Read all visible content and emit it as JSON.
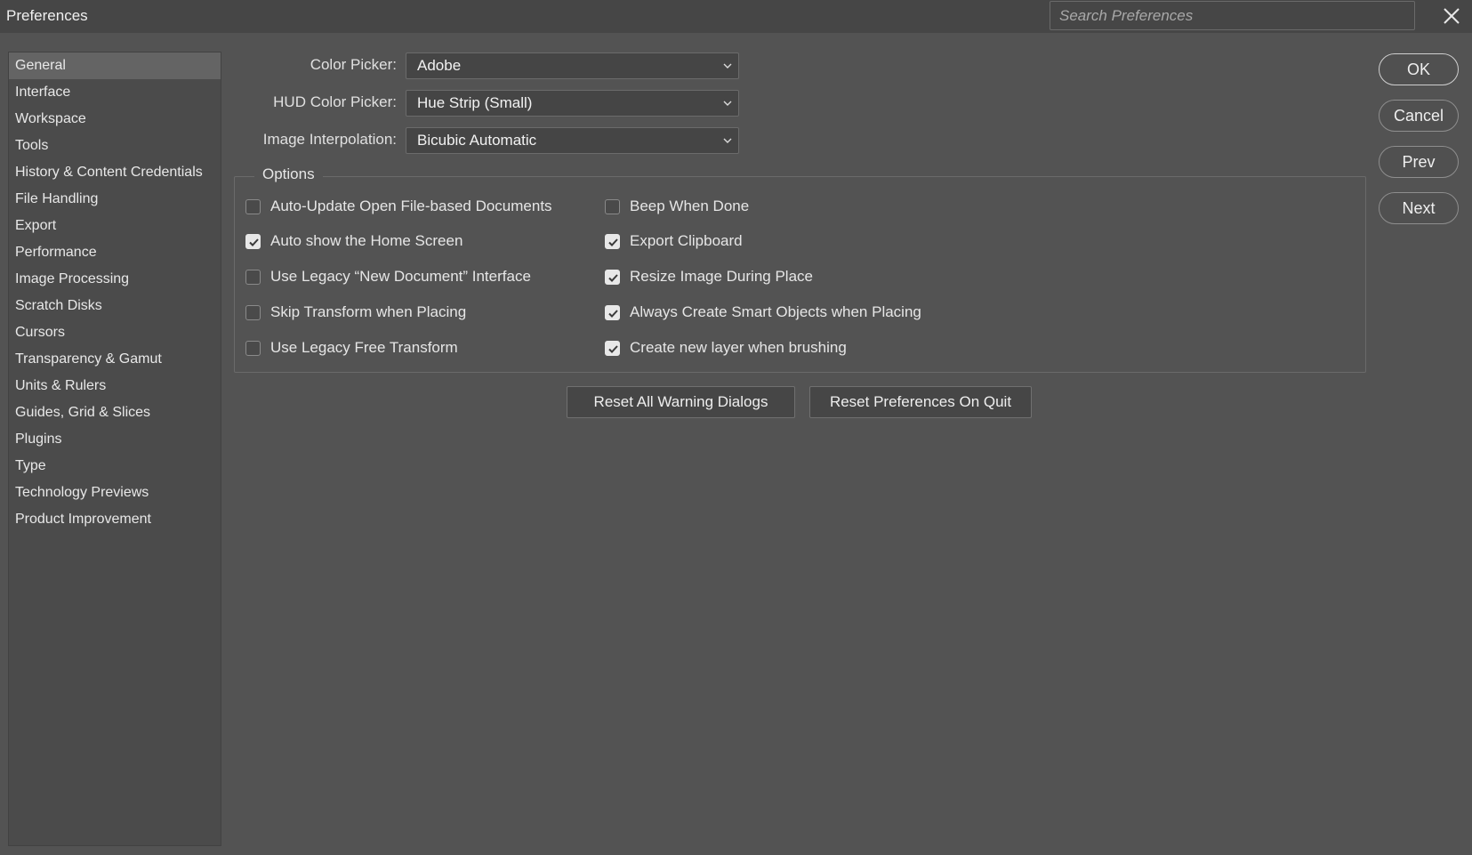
{
  "window": {
    "title": "Preferences",
    "search_placeholder": "Search Preferences"
  },
  "sidebar": {
    "items": [
      {
        "label": "General",
        "selected": true
      },
      {
        "label": "Interface"
      },
      {
        "label": "Workspace"
      },
      {
        "label": "Tools"
      },
      {
        "label": "History & Content Credentials"
      },
      {
        "label": "File Handling"
      },
      {
        "label": "Export"
      },
      {
        "label": "Performance"
      },
      {
        "label": "Image Processing"
      },
      {
        "label": "Scratch Disks"
      },
      {
        "label": "Cursors"
      },
      {
        "label": "Transparency & Gamut"
      },
      {
        "label": "Units & Rulers"
      },
      {
        "label": "Guides, Grid & Slices"
      },
      {
        "label": "Plugins"
      },
      {
        "label": "Type"
      },
      {
        "label": "Technology Previews"
      },
      {
        "label": "Product Improvement"
      }
    ]
  },
  "fields": {
    "color_picker": {
      "label": "Color Picker:",
      "value": "Adobe"
    },
    "hud_color_picker": {
      "label": "HUD Color Picker:",
      "value": "Hue Strip (Small)"
    },
    "image_interpolation": {
      "label": "Image Interpolation:",
      "value": "Bicubic Automatic"
    }
  },
  "options": {
    "title": "Options",
    "left": [
      {
        "label": "Auto-Update Open File-based Documents",
        "checked": false
      },
      {
        "label": "Auto show the Home Screen",
        "checked": true
      },
      {
        "label": "Use Legacy “New Document” Interface",
        "checked": false
      },
      {
        "label": "Skip Transform when Placing",
        "checked": false
      },
      {
        "label": "Use Legacy Free Transform",
        "checked": false
      }
    ],
    "right": [
      {
        "label": "Beep When Done",
        "checked": false
      },
      {
        "label": "Export Clipboard",
        "checked": true
      },
      {
        "label": "Resize Image During Place",
        "checked": true
      },
      {
        "label": "Always Create Smart Objects when Placing",
        "checked": true
      },
      {
        "label": "Create new layer when brushing",
        "checked": true
      }
    ]
  },
  "buttons": {
    "reset_warnings": "Reset All Warning Dialogs",
    "reset_prefs": "Reset Preferences On Quit",
    "ok": "OK",
    "cancel": "Cancel",
    "prev": "Prev",
    "next": "Next"
  },
  "icons": {
    "close": "close-icon",
    "dropdown": "chevron-down-icon",
    "check": "checkmark-icon"
  },
  "colors": {
    "background": "#535353",
    "titlebar": "#464646",
    "sidebar": "#4b4b4b",
    "selected_item": "#646464",
    "text": "#e6e6e6"
  }
}
